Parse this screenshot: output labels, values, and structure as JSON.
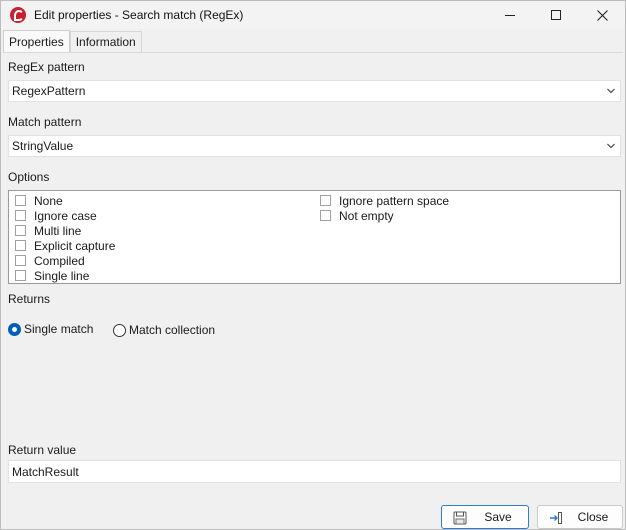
{
  "window": {
    "title": "Edit properties - Search match (RegEx)"
  },
  "tabs": [
    {
      "label": "Properties",
      "active": true
    },
    {
      "label": "Information",
      "active": false
    }
  ],
  "regex_pattern": {
    "label": "RegEx pattern",
    "value": "RegexPattern"
  },
  "match_pattern": {
    "label": "Match pattern",
    "value": "StringValue"
  },
  "options": {
    "label": "Options",
    "items": [
      {
        "label": "None",
        "checked": false
      },
      {
        "label": "Ignore case",
        "checked": false
      },
      {
        "label": "Multi line",
        "checked": false
      },
      {
        "label": "Explicit capture",
        "checked": false
      },
      {
        "label": "Compiled",
        "checked": false
      },
      {
        "label": "Single line",
        "checked": false
      },
      {
        "label": "Ignore pattern space",
        "checked": false
      },
      {
        "label": "Not empty",
        "checked": false
      }
    ]
  },
  "returns": {
    "label": "Returns",
    "choices": [
      {
        "label": "Single match",
        "selected": true
      },
      {
        "label": "Match collection",
        "selected": false
      }
    ]
  },
  "return_value": {
    "label": "Return value",
    "value": "MatchResult"
  },
  "footer": {
    "save_label": "Save",
    "close_label": "Close"
  },
  "colors": {
    "accent": "#005fb8",
    "brand": "#c8202f"
  }
}
